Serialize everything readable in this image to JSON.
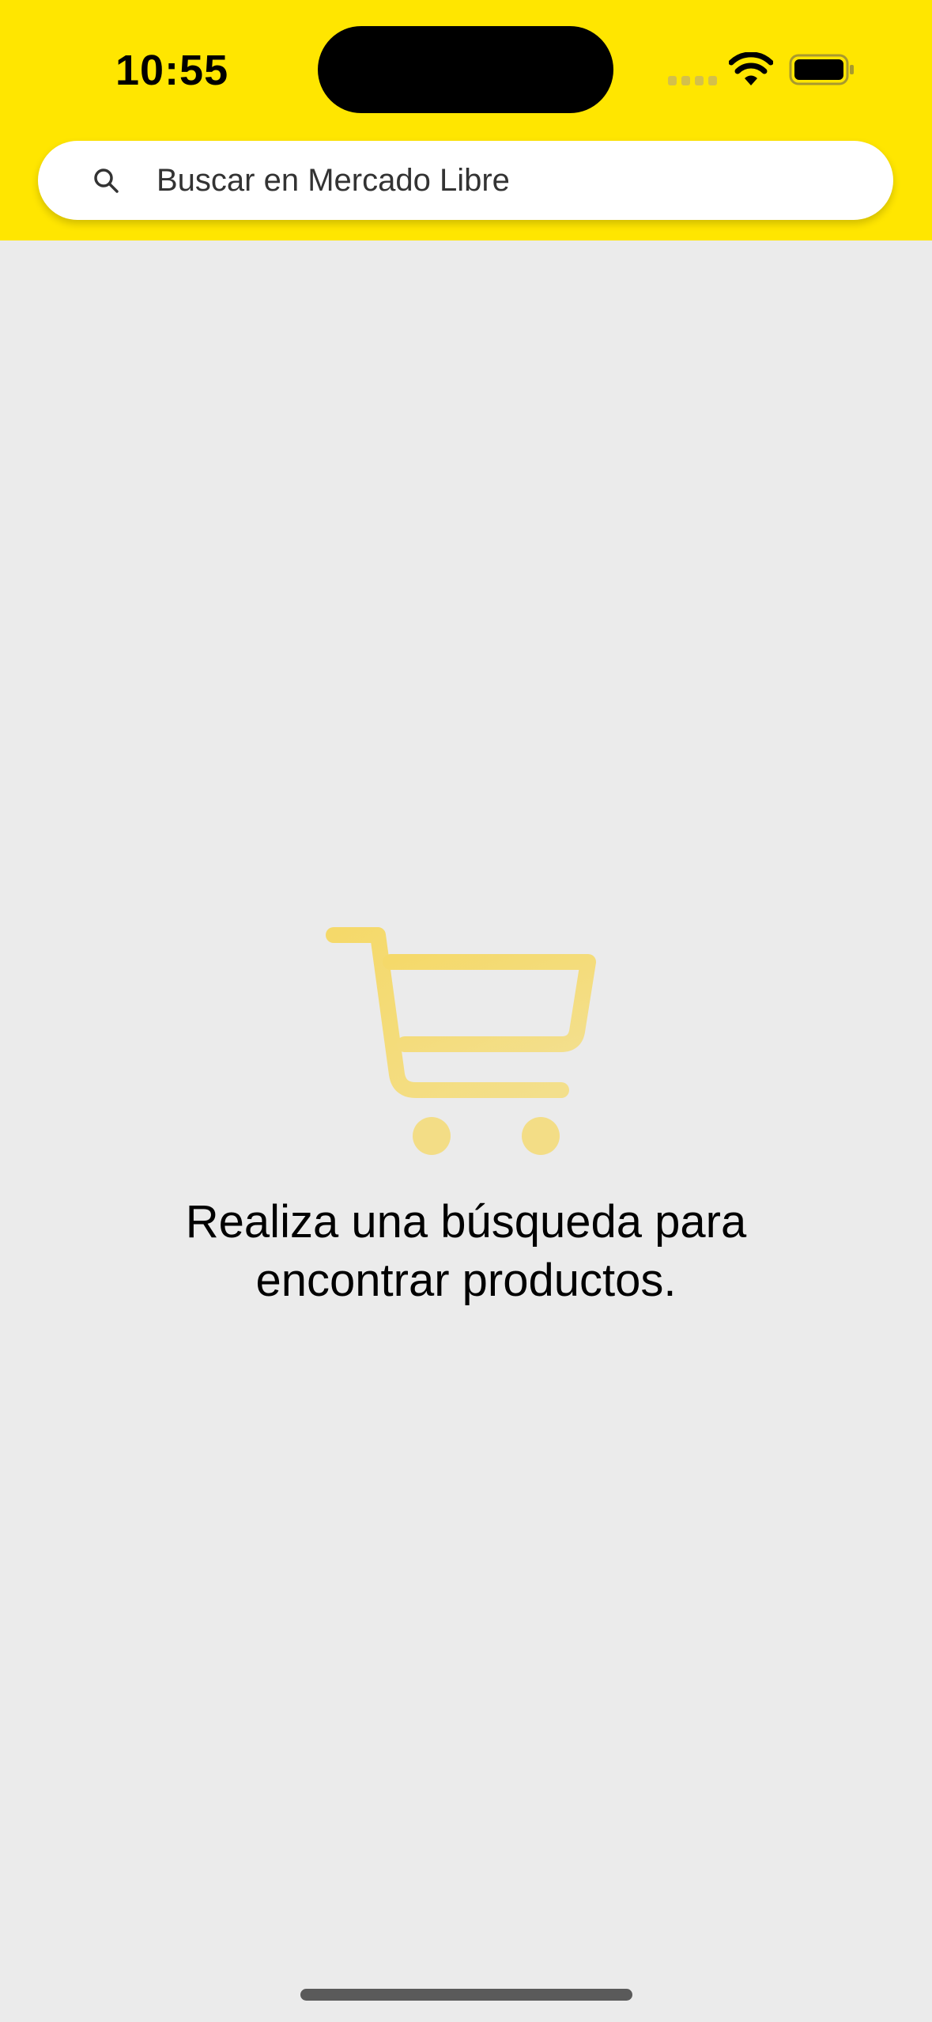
{
  "status_bar": {
    "time": "10:55",
    "icons": [
      "cellular-signal-icon",
      "wifi-icon",
      "battery-icon"
    ]
  },
  "search": {
    "placeholder": "Buscar en Mercado Libre",
    "value": "",
    "icon": "search-icon"
  },
  "empty_state": {
    "icon": "shopping-cart-icon",
    "message": "Realiza una búsqueda para encontrar productos."
  },
  "colors": {
    "brand_yellow": "#ffe600",
    "cart_icon": "#f5d96a",
    "background": "#ebebeb"
  }
}
